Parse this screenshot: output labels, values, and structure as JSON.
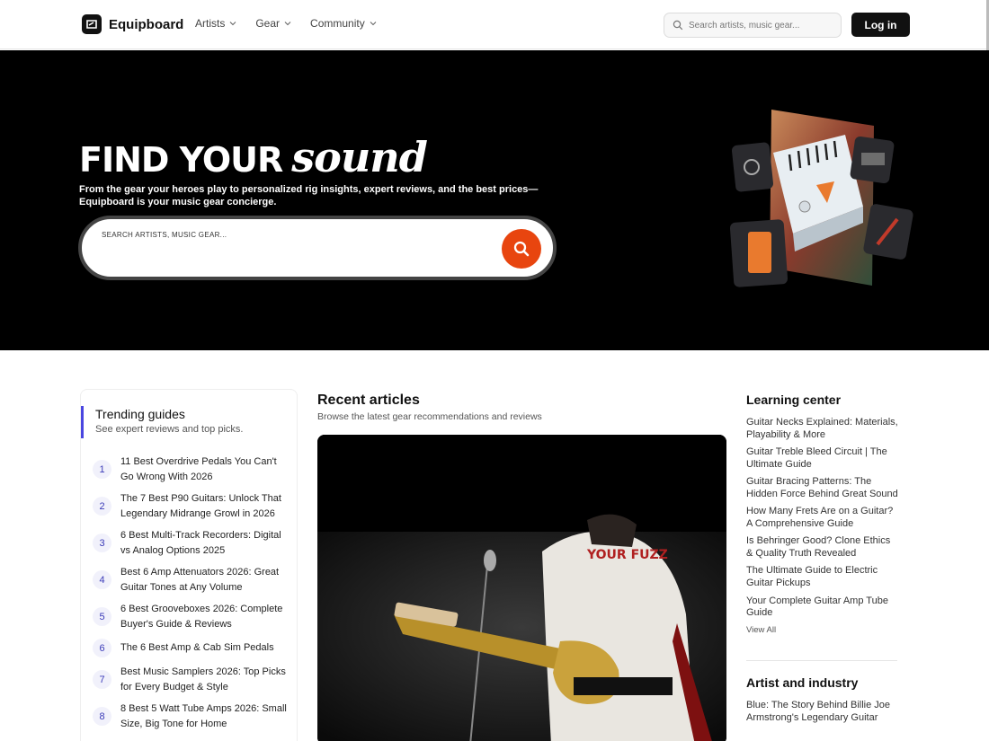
{
  "header": {
    "brand": "Equipboard",
    "nav": [
      {
        "label": "Artists"
      },
      {
        "label": "Gear"
      },
      {
        "label": "Community"
      }
    ],
    "search_placeholder": "Search artists, music gear...",
    "login_label": "Log in"
  },
  "hero": {
    "title_bold": "FIND YOUR",
    "title_script": "sound",
    "subtitle": "From the gear your heroes play to personalized rig insights, expert reviews, and the best prices—Equipboard is your music gear concierge.",
    "search_placeholder": "SEARCH ARTISTS, MUSIC GEAR...",
    "accent_color": "#e8450f"
  },
  "trending": {
    "title": "Trending guides",
    "subtitle": "See expert reviews and top picks.",
    "items": [
      {
        "num": "1",
        "title": "11 Best Overdrive Pedals You Can't Go Wrong With 2026"
      },
      {
        "num": "2",
        "title": "The 7 Best P90 Guitars: Unlock That Legendary Midrange Growl in 2026"
      },
      {
        "num": "3",
        "title": "6 Best Multi-Track Recorders: Digital vs Analog Options 2025"
      },
      {
        "num": "4",
        "title": "Best 6 Amp Attenuators 2026: Great Guitar Tones at Any Volume"
      },
      {
        "num": "5",
        "title": "6 Best Grooveboxes 2026: Complete Buyer's Guide & Reviews"
      },
      {
        "num": "6",
        "title": "The 6 Best Amp & Cab Sim Pedals"
      },
      {
        "num": "7",
        "title": "Best Music Samplers 2026: Top Picks for Every Budget & Style"
      },
      {
        "num": "8",
        "title": "8 Best 5 Watt Tube Amps 2026: Small Size, Big Tone for Home"
      }
    ]
  },
  "recent": {
    "title": "Recent articles",
    "subtitle": "Browse the latest gear recommendations and reviews",
    "shirt_text": "YOUR FUZZ"
  },
  "learning": {
    "title": "Learning center",
    "links": [
      "Guitar Necks Explained: Materials, Playability & More",
      "Guitar Treble Bleed Circuit | The Ultimate Guide",
      "Guitar Bracing Patterns: The Hidden Force Behind Great Sound",
      "How Many Frets Are on a Guitar? A Comprehensive Guide",
      "Is Behringer Good? Clone Ethics & Quality Truth Revealed",
      "The Ultimate Guide to Electric Guitar Pickups",
      "Your Complete Guitar Amp Tube Guide"
    ],
    "view_all": "View All"
  },
  "artist": {
    "title": "Artist and industry",
    "links": [
      "Blue: The Story Behind Billie Joe Armstrong's Legendary Guitar"
    ]
  }
}
